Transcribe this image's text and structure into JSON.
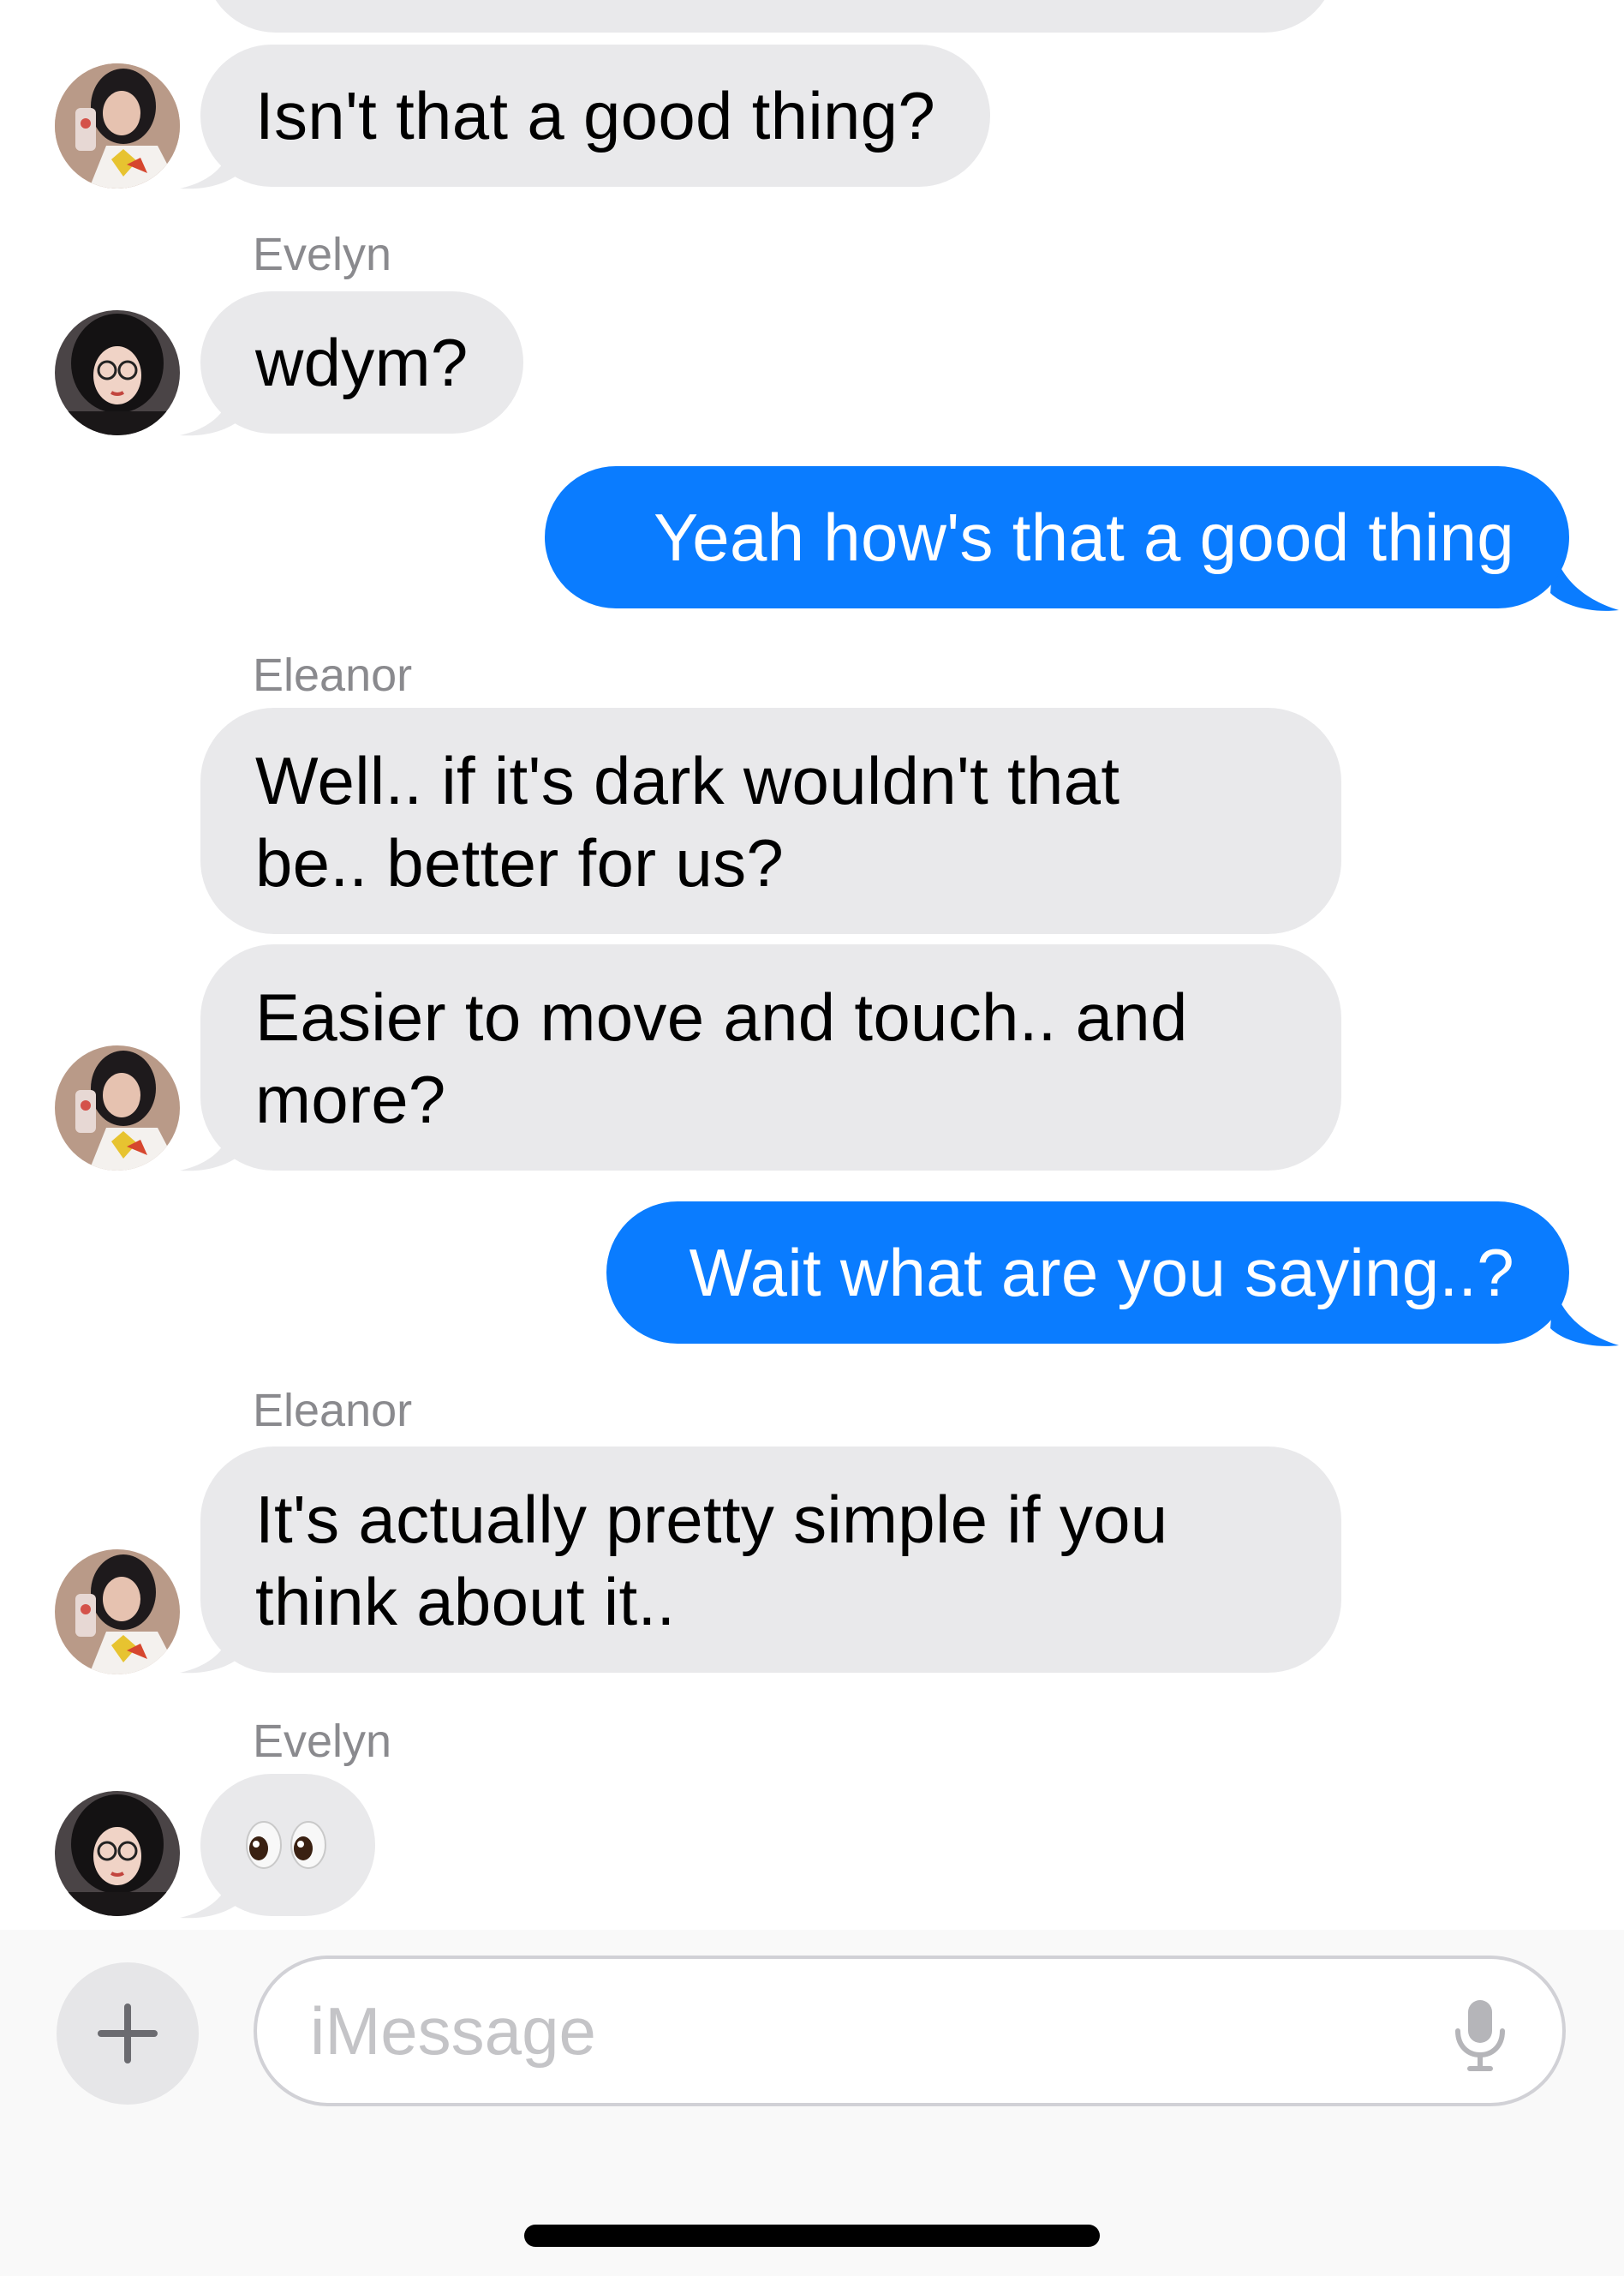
{
  "messages": [
    {
      "id": "m0",
      "direction": "incoming",
      "text": ""
    },
    {
      "id": "m1",
      "direction": "incoming",
      "text": "Isn't that a good thing?"
    },
    {
      "id": "m2",
      "direction": "incoming",
      "sender": "Evelyn",
      "text": "wdym?"
    },
    {
      "id": "m3",
      "direction": "outgoing",
      "text": "Yeah how's that a good thing"
    },
    {
      "id": "m4",
      "direction": "incoming",
      "sender": "Eleanor",
      "text": "Well.. if it's dark wouldn't that\nbe.. better for us?"
    },
    {
      "id": "m5",
      "direction": "incoming",
      "text": "Easier to move and touch.. and\nmore?"
    },
    {
      "id": "m6",
      "direction": "outgoing",
      "text": "Wait what are you saying..?"
    },
    {
      "id": "m7",
      "direction": "incoming",
      "sender": "Eleanor",
      "text": "It's actually pretty simple if you\nthink about it.."
    },
    {
      "id": "m8",
      "direction": "incoming",
      "sender": "Evelyn",
      "emoji": "eyes"
    }
  ],
  "senders": {
    "evelyn": "Evelyn",
    "eleanor_1": "Eleanor",
    "eleanor_2": "Eleanor",
    "evelyn_2": "Evelyn"
  },
  "composer": {
    "placeholder": "iMessage",
    "plus_icon": "plus-icon",
    "mic_icon": "microphone-icon"
  },
  "colors": {
    "incoming_bubble": "#e9e9eb",
    "outgoing_bubble": "#0a7cff",
    "sender_label": "#8a8a8e",
    "placeholder": "#c4c4c7"
  }
}
